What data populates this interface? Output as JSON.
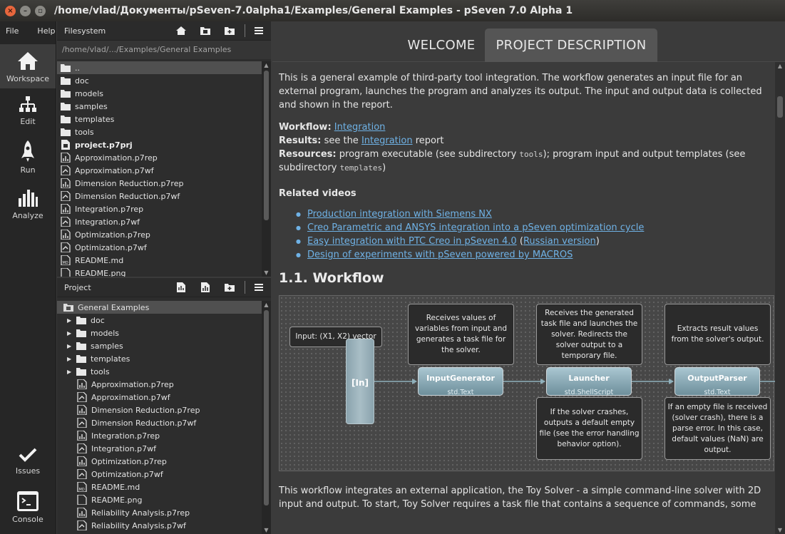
{
  "window": {
    "title": "/home/vlad/Документы/pSeven-7.0alpha1/Examples/General Examples - pSeven 7.0 Alpha 1"
  },
  "menu": {
    "file": "File",
    "help": "Help"
  },
  "nav": [
    {
      "label": "Workspace",
      "icon": "home-icon",
      "active": true
    },
    {
      "label": "Edit",
      "icon": "workflow-icon",
      "active": false
    },
    {
      "label": "Run",
      "icon": "rocket-icon",
      "active": false
    },
    {
      "label": "Analyze",
      "icon": "bar-chart-icon",
      "active": false
    },
    {
      "label": "Issues",
      "icon": "checkmark-icon",
      "active": false
    },
    {
      "label": "Console",
      "icon": "terminal-icon",
      "active": false
    }
  ],
  "filesystem": {
    "title": "Filesystem",
    "path": "/home/vlad/.../Examples/General Examples",
    "items": [
      {
        "name": "..",
        "type": "folder"
      },
      {
        "name": "doc",
        "type": "folder"
      },
      {
        "name": "models",
        "type": "folder"
      },
      {
        "name": "samples",
        "type": "folder"
      },
      {
        "name": "templates",
        "type": "folder"
      },
      {
        "name": "tools",
        "type": "folder"
      },
      {
        "name": "project.p7prj",
        "type": "project"
      },
      {
        "name": "Approximation.p7rep",
        "type": "report"
      },
      {
        "name": "Approximation.p7wf",
        "type": "workflow"
      },
      {
        "name": "Dimension Reduction.p7rep",
        "type": "report"
      },
      {
        "name": "Dimension Reduction.p7wf",
        "type": "workflow"
      },
      {
        "name": "Integration.p7rep",
        "type": "report"
      },
      {
        "name": "Integration.p7wf",
        "type": "workflow"
      },
      {
        "name": "Optimization.p7rep",
        "type": "report"
      },
      {
        "name": "Optimization.p7wf",
        "type": "workflow"
      },
      {
        "name": "README.md",
        "type": "markdown"
      },
      {
        "name": "README.png",
        "type": "image"
      }
    ]
  },
  "project": {
    "title": "Project",
    "root": "General Examples",
    "items": [
      {
        "name": "doc",
        "type": "folder"
      },
      {
        "name": "models",
        "type": "folder"
      },
      {
        "name": "samples",
        "type": "folder"
      },
      {
        "name": "templates",
        "type": "folder"
      },
      {
        "name": "tools",
        "type": "folder"
      },
      {
        "name": "Approximation.p7rep",
        "type": "report"
      },
      {
        "name": "Approximation.p7wf",
        "type": "workflow"
      },
      {
        "name": "Dimension Reduction.p7rep",
        "type": "report"
      },
      {
        "name": "Dimension Reduction.p7wf",
        "type": "workflow"
      },
      {
        "name": "Integration.p7rep",
        "type": "report"
      },
      {
        "name": "Integration.p7wf",
        "type": "workflow"
      },
      {
        "name": "Optimization.p7rep",
        "type": "report"
      },
      {
        "name": "Optimization.p7wf",
        "type": "workflow"
      },
      {
        "name": "README.md",
        "type": "markdown"
      },
      {
        "name": "README.png",
        "type": "image"
      },
      {
        "name": "Reliability Analysis.p7rep",
        "type": "report"
      },
      {
        "name": "Reliability Analysis.p7wf",
        "type": "workflow"
      }
    ]
  },
  "tabs": {
    "welcome": "WELCOME",
    "description": "PROJECT DESCRIPTION"
  },
  "doc": {
    "intro": "This is a general example of third-party tool integration. The workflow generates an input file for an external program, launches the program and analyzes its output. The input and output data is collected and shown in the report.",
    "workflow_label": "Workflow:",
    "workflow_link": "Integration",
    "results_label": "Results:",
    "results_pre": " see the ",
    "results_link": "Integration",
    "results_post": " report",
    "resources_label": "Resources:",
    "resources_a": " program executable (see subdirectory ",
    "resources_code1": "tools",
    "resources_b": "); program input and output templates (see subdirectory ",
    "resources_code2": "templates",
    "resources_c": ")",
    "related_title": "Related videos",
    "videos": {
      "v1": "Production integration with Siemens NX",
      "v2": "Creo Parametric and ANSYS integration into a pSeven optimization cycle",
      "v3": "Easy integration with PTC Creo in pSeven 4.0",
      "v3_paren_open": " (",
      "v3_alt": "Russian version",
      "v3_paren_close": ")",
      "v4": "Design of experiments with pSeven powered by MACROS"
    },
    "section_heading": "1.1. Workflow",
    "outro": "This workflow integrates an external application, the Toy Solver - a simple command-line solver with 2D input and output. To start, Toy Solver requires a task file that contains a sequence of commands, some"
  },
  "diagram": {
    "input_note": "Input: (X1, X2) vector",
    "in_block": "[In]",
    "blocks": [
      {
        "title": "InputGenerator",
        "subtitle": "std.Text"
      },
      {
        "title": "Launcher",
        "subtitle": "std.ShellScript"
      },
      {
        "title": "OutputParser",
        "subtitle": "std.Text"
      }
    ],
    "notes": {
      "generator": "Receives values of variables from input and generates a task file for the solver.",
      "launcher": "Receives the generated task file and launches the solver. Redirects the solver output to a temporary file.",
      "parser": "Extracts result values from the solver's output.",
      "crash": "If the solver crashes, outputs a default empty file (see the error handling behavior option).",
      "empty": "If an empty file is received (solver crash), there is a parse error. In this case, default values (NaN) are output."
    }
  }
}
